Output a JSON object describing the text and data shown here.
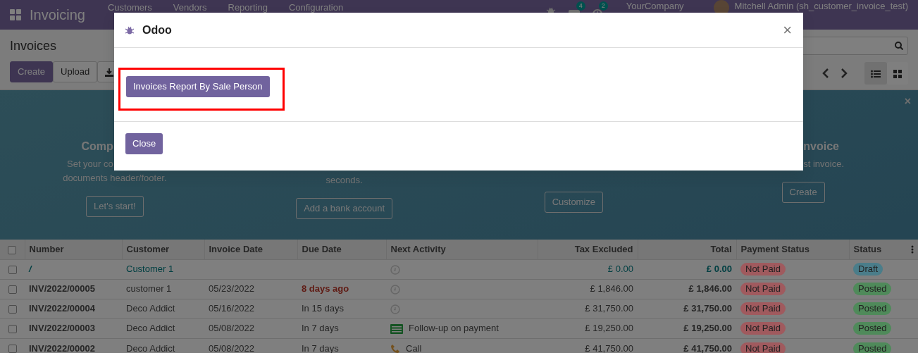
{
  "navbar": {
    "app_name": "Invoicing",
    "menu": [
      "Customers",
      "Vendors",
      "Reporting",
      "Configuration"
    ],
    "messages_count": "4",
    "activities_count": "2",
    "company": "YourCompany",
    "user": "Mitchell Admin (sh_customer_invoice_test)"
  },
  "control_panel": {
    "title": "Invoices",
    "buttons": [
      {
        "label": "Create",
        "kind": "primary"
      },
      {
        "label": "Upload",
        "kind": "secondary"
      }
    ],
    "views": [
      {
        "kind": "list",
        "selected": true
      },
      {
        "kind": "kanban",
        "selected": false
      }
    ]
  },
  "onboarding": {
    "steps": [
      {
        "title": "Comp",
        "lines": [
          "Set your co",
          "documents header/footer."
        ],
        "button": "Let's start!"
      },
      {
        "lines": [
          "seconds."
        ],
        "button": "Add a bank account"
      },
      {
        "button": "Customize"
      },
      {
        "title": "nvoice",
        "lines": [
          "st invoice."
        ],
        "button": "Create"
      }
    ],
    "close_glyph": "×"
  },
  "table": {
    "header_checked": false,
    "columns": [
      "Number",
      "Customer",
      "Invoice Date",
      "Due Date",
      "Next Activity",
      "Tax Excluded",
      "Total",
      "Payment Status",
      "Status"
    ],
    "rows": [
      {
        "checked": false,
        "draft": true,
        "number": "/",
        "customer": "Customer 1",
        "activity": {
          "kind": "clock"
        },
        "tax_excluded": "£ 0.00",
        "total": "£ 0.00",
        "payment_status": {
          "label": "Not Paid",
          "color": "#a05a5e"
        },
        "status": {
          "label": "Draft",
          "color": "#4a7d8a"
        }
      },
      {
        "checked": false,
        "draft": false,
        "number": "INV/2022/00005",
        "customer": "customer 1",
        "invoice_date": "05/23/2022",
        "due_date": "8 days ago",
        "overdue": true,
        "activity": {
          "kind": "clock"
        },
        "tax_excluded": "£ 1,846.00",
        "total": "£ 1,846.00",
        "payment_status": {
          "label": "Not Paid",
          "color": "#a05a5e"
        },
        "status": {
          "label": "Posted",
          "color": "#4f8a5a"
        }
      },
      {
        "checked": false,
        "draft": false,
        "number": "INV/2022/00004",
        "customer": "Deco Addict",
        "invoice_date": "05/16/2022",
        "due_date": "In 15 days",
        "overdue": false,
        "activity": {
          "kind": "clock"
        },
        "tax_excluded": "£ 31,750.00",
        "total": "£ 31,750.00",
        "payment_status": {
          "label": "Not Paid",
          "color": "#a05a5e"
        },
        "status": {
          "label": "Posted",
          "color": "#4f8a5a"
        }
      },
      {
        "checked": false,
        "draft": false,
        "number": "INV/2022/00003",
        "customer": "Deco Addict",
        "invoice_date": "05/08/2022",
        "due_date": "In 7 days",
        "overdue": false,
        "activity": {
          "kind": "todo",
          "label": "Follow-up on payment"
        },
        "tax_excluded": "£ 19,250.00",
        "total": "£ 19,250.00",
        "payment_status": {
          "label": "Not Paid",
          "color": "#a05a5e"
        },
        "status": {
          "label": "Posted",
          "color": "#4f8a5a"
        }
      },
      {
        "checked": false,
        "draft": false,
        "number": "INV/2022/00002",
        "customer": "Deco Addict",
        "invoice_date": "05/08/2022",
        "due_date": "In 7 days",
        "overdue": false,
        "activity": {
          "kind": "call",
          "label": "Call"
        },
        "tax_excluded": "£ 41,750.00",
        "total": "£ 41,750.00",
        "payment_status": {
          "label": "Not Paid",
          "color": "#a05a5e"
        },
        "status": {
          "label": "Posted",
          "color": "#4f8a5a"
        }
      }
    ]
  },
  "dialog": {
    "title": "Odoo",
    "close_glyph": "×",
    "action_button": "Invoices Report By Sale Person",
    "footer_button": "Close"
  }
}
